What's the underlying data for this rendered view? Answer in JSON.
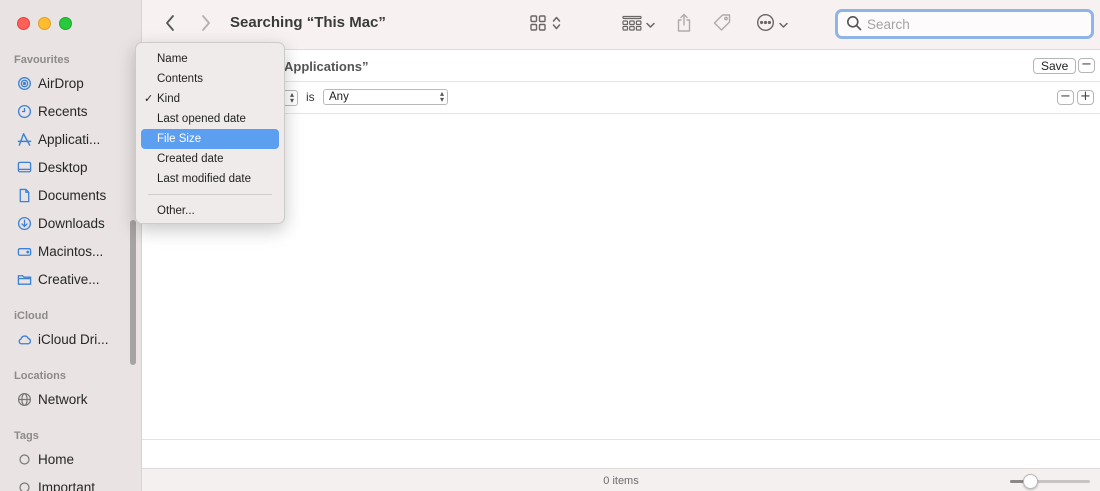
{
  "window": {
    "title": "Searching “This Mac”"
  },
  "sidebar": {
    "sections": [
      {
        "title": "Favourites"
      },
      {
        "title": "iCloud"
      },
      {
        "title": "Locations"
      },
      {
        "title": "Tags"
      }
    ],
    "favourites": [
      {
        "label": "AirDrop",
        "icon": "airdrop-icon"
      },
      {
        "label": "Recents",
        "icon": "clock-icon"
      },
      {
        "label": "Applicati...",
        "icon": "applications-icon"
      },
      {
        "label": "Desktop",
        "icon": "desktop-icon"
      },
      {
        "label": "Documents",
        "icon": "document-icon"
      },
      {
        "label": "Downloads",
        "icon": "download-icon"
      },
      {
        "label": "Macintos...",
        "icon": "drive-icon"
      },
      {
        "label": "Creative...",
        "icon": "folder-icon"
      }
    ],
    "icloud": [
      {
        "label": "iCloud Dri...",
        "icon": "cloud-icon"
      }
    ],
    "locations": [
      {
        "label": "Network",
        "icon": "globe-icon"
      }
    ],
    "tags": [
      {
        "label": "Home",
        "icon": "tag-circle-icon"
      },
      {
        "label": "Important",
        "icon": "tag-circle-icon"
      }
    ]
  },
  "search": {
    "placeholder": "Search"
  },
  "scope_bar": {
    "label": "Applications”",
    "save_label": "Save",
    "remove_label": "−"
  },
  "rule_row": {
    "operator": "is",
    "value": "Any",
    "remove_label": "−",
    "add_label": "+"
  },
  "attribute_menu": {
    "items": [
      {
        "label": "Name",
        "checked": false,
        "selected": false
      },
      {
        "label": "Contents",
        "checked": false,
        "selected": false
      },
      {
        "label": "Kind",
        "checked": true,
        "selected": false
      },
      {
        "label": "Last opened date",
        "checked": false,
        "selected": false
      },
      {
        "label": "File Size",
        "checked": false,
        "selected": true
      },
      {
        "label": "Created date",
        "checked": false,
        "selected": false
      },
      {
        "label": "Last modified date",
        "checked": false,
        "selected": false
      }
    ],
    "other_label": "Other...",
    "check_glyph": "✓"
  },
  "status": {
    "items_text": "0 items",
    "zoom_level": 0.25
  },
  "colors": {
    "accent": "#5c9ef0",
    "search_focus": "#8fb4e8",
    "sidebar_icon": "#3b82d6",
    "close": "#fe5f57",
    "minimize": "#febc2e",
    "maximize": "#28c840"
  }
}
